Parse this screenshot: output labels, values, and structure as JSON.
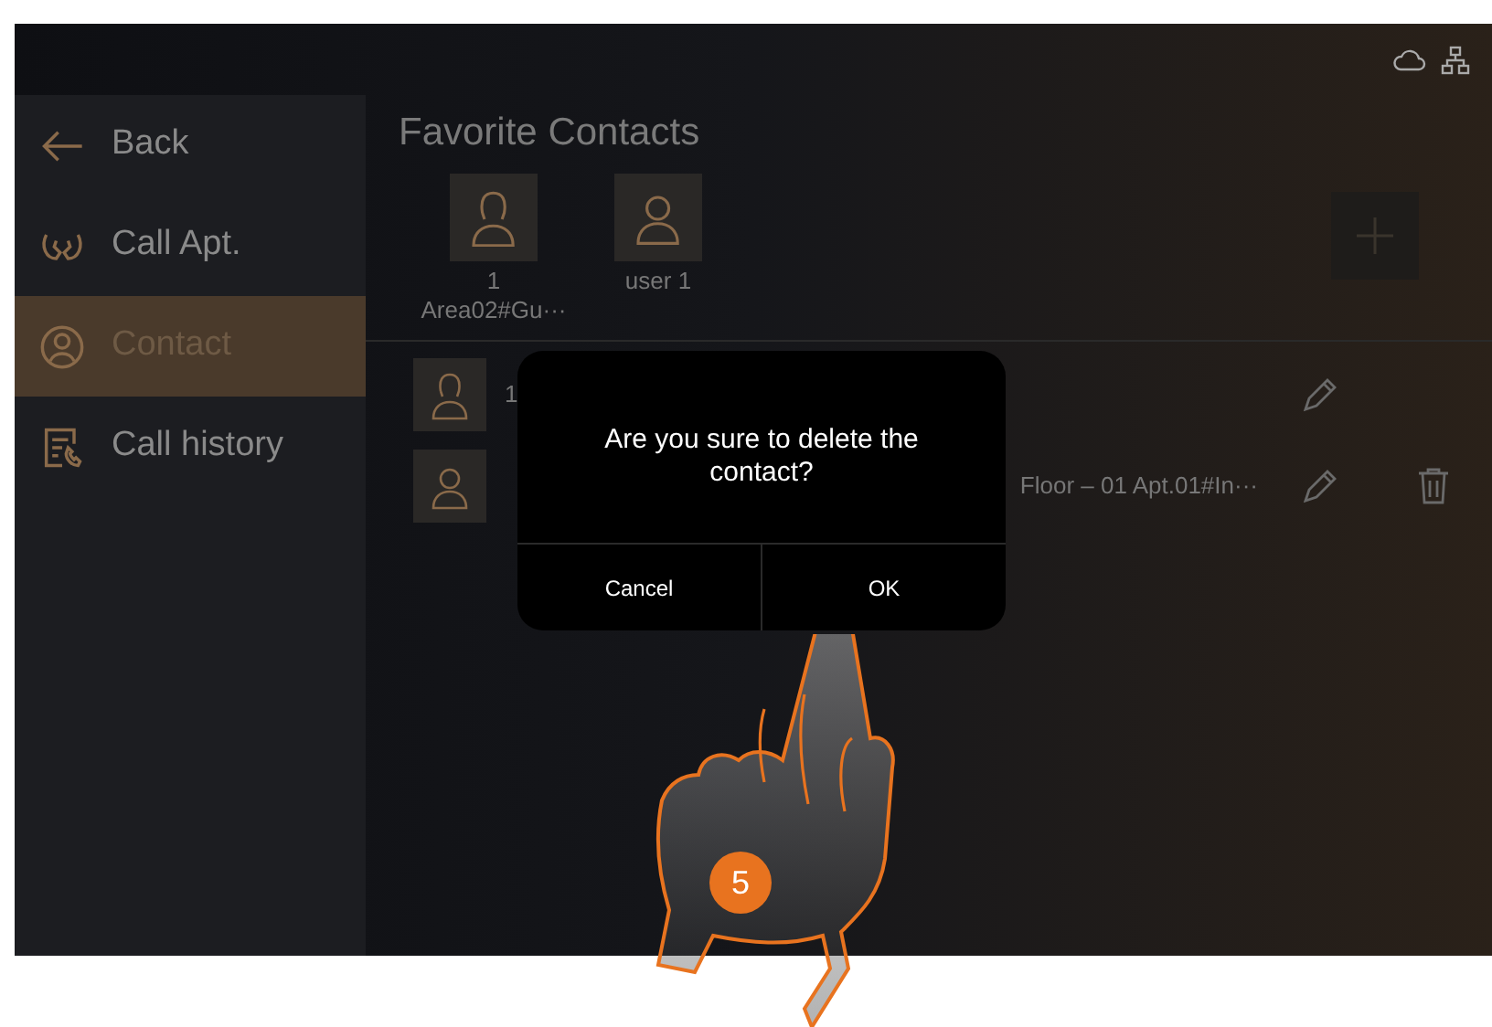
{
  "sidebar": {
    "items": [
      {
        "label": "Back",
        "kind": "back",
        "selected": false
      },
      {
        "label": "Call Apt.",
        "kind": "call",
        "selected": false
      },
      {
        "label": "Contact",
        "kind": "contact",
        "selected": true
      },
      {
        "label": "Call history",
        "kind": "history",
        "selected": false
      }
    ]
  },
  "favorites": {
    "title": "Favorite Contacts",
    "items": [
      {
        "lines": [
          "1",
          "Area02#Gu···"
        ],
        "kind": "female"
      },
      {
        "lines": [
          "user 1"
        ],
        "kind": "male"
      }
    ]
  },
  "contacts": [
    {
      "name": "1",
      "kind": "female",
      "deletable": false
    },
    {
      "name": "Floor – 01 Apt.01#In···",
      "kind": "male",
      "deletable": true
    }
  ],
  "dialog": {
    "message": "Are you sure to delete the contact?",
    "buttons": [
      "Cancel",
      "OK"
    ]
  },
  "step": "5"
}
